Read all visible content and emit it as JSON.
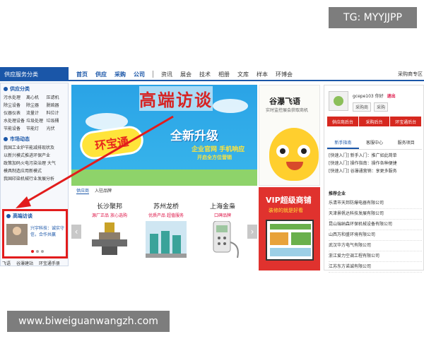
{
  "watermarks": {
    "top": "TG: MYYJJPP",
    "bottom": "www.biweiguanwangzh.com"
  },
  "nav": {
    "category": "供应服务分类",
    "primary": [
      "首页",
      "供应",
      "采购",
      "公司"
    ],
    "secondary": [
      "资讯",
      "展会",
      "技术",
      "相册",
      "文库",
      "样本",
      "环博会"
    ],
    "right": "采购商专区"
  },
  "sidebar": {
    "sections": [
      {
        "title": "供应分类",
        "items": [
          "污水处理",
          "离心机",
          "压滤机",
          "除尘设备",
          "除尘器",
          "脱硫器",
          "仪器仪表",
          "流量计",
          "料位计",
          "水处理设备",
          "垃圾处理",
          "垃圾桶",
          "节能设备",
          "节能灯",
          "光伏"
        ]
      }
    ],
    "news": {
      "title": "市场动态",
      "items": [
        "我国工业炉节能减排现状及",
        "以新兴模式推进环保产业",
        "政策加码火电污染治理 大气",
        "模具制造应用新模式",
        "我国印染机械行业发展分析"
      ]
    },
    "interview": {
      "title": "高端访谈",
      "text": "兴宇科技：诚实守信，合作共赢"
    },
    "footer": [
      "飞语",
      "谷瀑建站",
      "环宝通手册"
    ]
  },
  "banner": {
    "overlay_title": "高端访谈",
    "ring": "环宝通",
    "upgrade": "全新升级",
    "sub": "企业官网 手机响应",
    "sub2": "开启全方位营销"
  },
  "products": {
    "tabs": [
      "供应商",
      "入驻品牌"
    ],
    "items": [
      {
        "name": "长沙聚邦",
        "tag": "源厂正品 放心选购"
      },
      {
        "name": "苏州龙桥",
        "tag": "优质产品 超值服务"
      },
      {
        "name": "上海金枭",
        "tag": "口碑品牌"
      }
    ],
    "prev": "‹",
    "next": "›"
  },
  "ad_top": {
    "title": "谷瀑飞语",
    "subtitle": "实时监控展会获取商机"
  },
  "ad_vip": {
    "title": "VIP超级商铺",
    "subtitle": "装修的就是好看"
  },
  "user": {
    "name": "gcepe103",
    "greeting": "你好",
    "logout": "退出",
    "buttons": [
      "采购商",
      "采购"
    ],
    "actions": [
      "供应商后台",
      "采购后台",
      "环宝通后台"
    ],
    "tabs": [
      "新手指南",
      "客服中心",
      "服务项目"
    ],
    "guide": [
      "[快速入门] 新手入门：推广如此简单",
      "[快速入门] 操作指南：操作各种便捷",
      "[快速入门] 谷瀑通营销：享更多服务"
    ],
    "rec_title": "推荐企业",
    "recommended": [
      "乐清市天邦防爆电器有限公司",
      "天津景帆达科技发展有限公司",
      "昆山瑞纳森环保机械设备有限公司",
      "山西万和盛环境有限公司",
      "武汉华方电气有限公司",
      "浙江爱力空调工程有限公司",
      "江苏东方诺诚有限公司"
    ]
  }
}
